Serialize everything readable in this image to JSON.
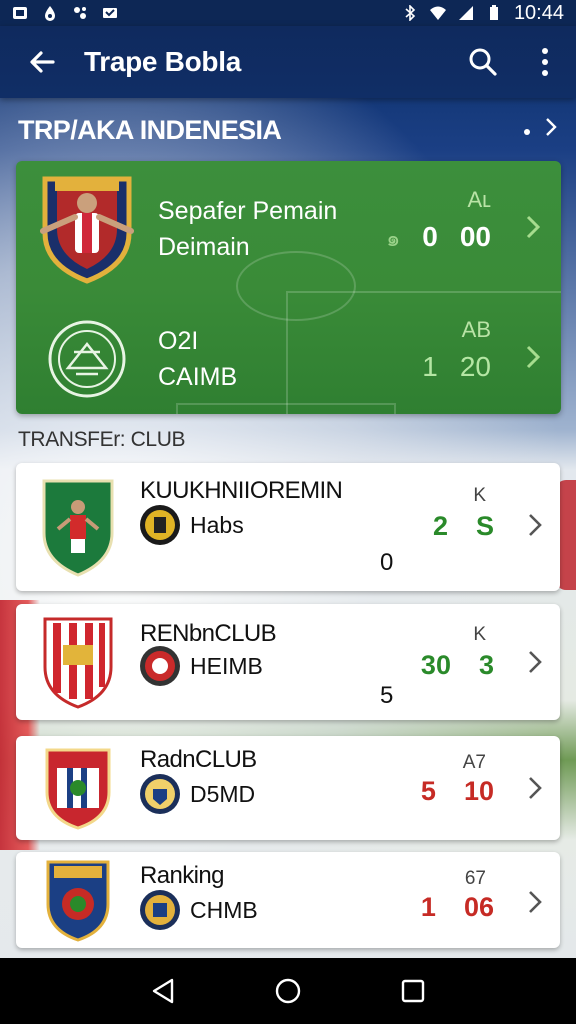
{
  "status_bar": {
    "time": "10:44"
  },
  "app_bar": {
    "title": "Trape Bobla"
  },
  "league": {
    "title": "TRP/AKA INDENESIA"
  },
  "featured": [
    {
      "line1": "Sepafer Pemain",
      "line2": "Deimain",
      "label": "Aʟ",
      "small": "๑",
      "score_a": "0",
      "score_b": "00"
    },
    {
      "line1": "O2I",
      "line2": "CAIMB",
      "label": "AB",
      "small": "",
      "score_a": "1",
      "score_b": "20"
    }
  ],
  "transfer_section": {
    "title": "TRANSFEr: CLUB"
  },
  "cards": [
    {
      "title": "KUUKHNIIOREMIN",
      "sub": "Habs",
      "label": "K",
      "num_a": "2",
      "num_b": "S",
      "extra": "0",
      "color_a": "#2a8a2a",
      "color_b": "#2a8a2a"
    },
    {
      "title": "RENbnCLUB",
      "sub": "HEIMB",
      "label": "K",
      "num_a": "30",
      "num_b": "3",
      "extra": "5",
      "color_a": "#2a8a2a",
      "color_b": "#2a8a2a"
    },
    {
      "title": "RadnCLUB",
      "sub": "D5MD",
      "label": "A7",
      "num_a": "5",
      "num_b": "10",
      "extra": "",
      "color_a": "#c62b25",
      "color_b": "#c62b25"
    },
    {
      "title": "Ranking",
      "sub": "CHMB",
      "label": "67",
      "num_a": "1",
      "num_b": "06",
      "extra": "",
      "color_a": "#c62b25",
      "color_b": "#c62b25"
    }
  ]
}
